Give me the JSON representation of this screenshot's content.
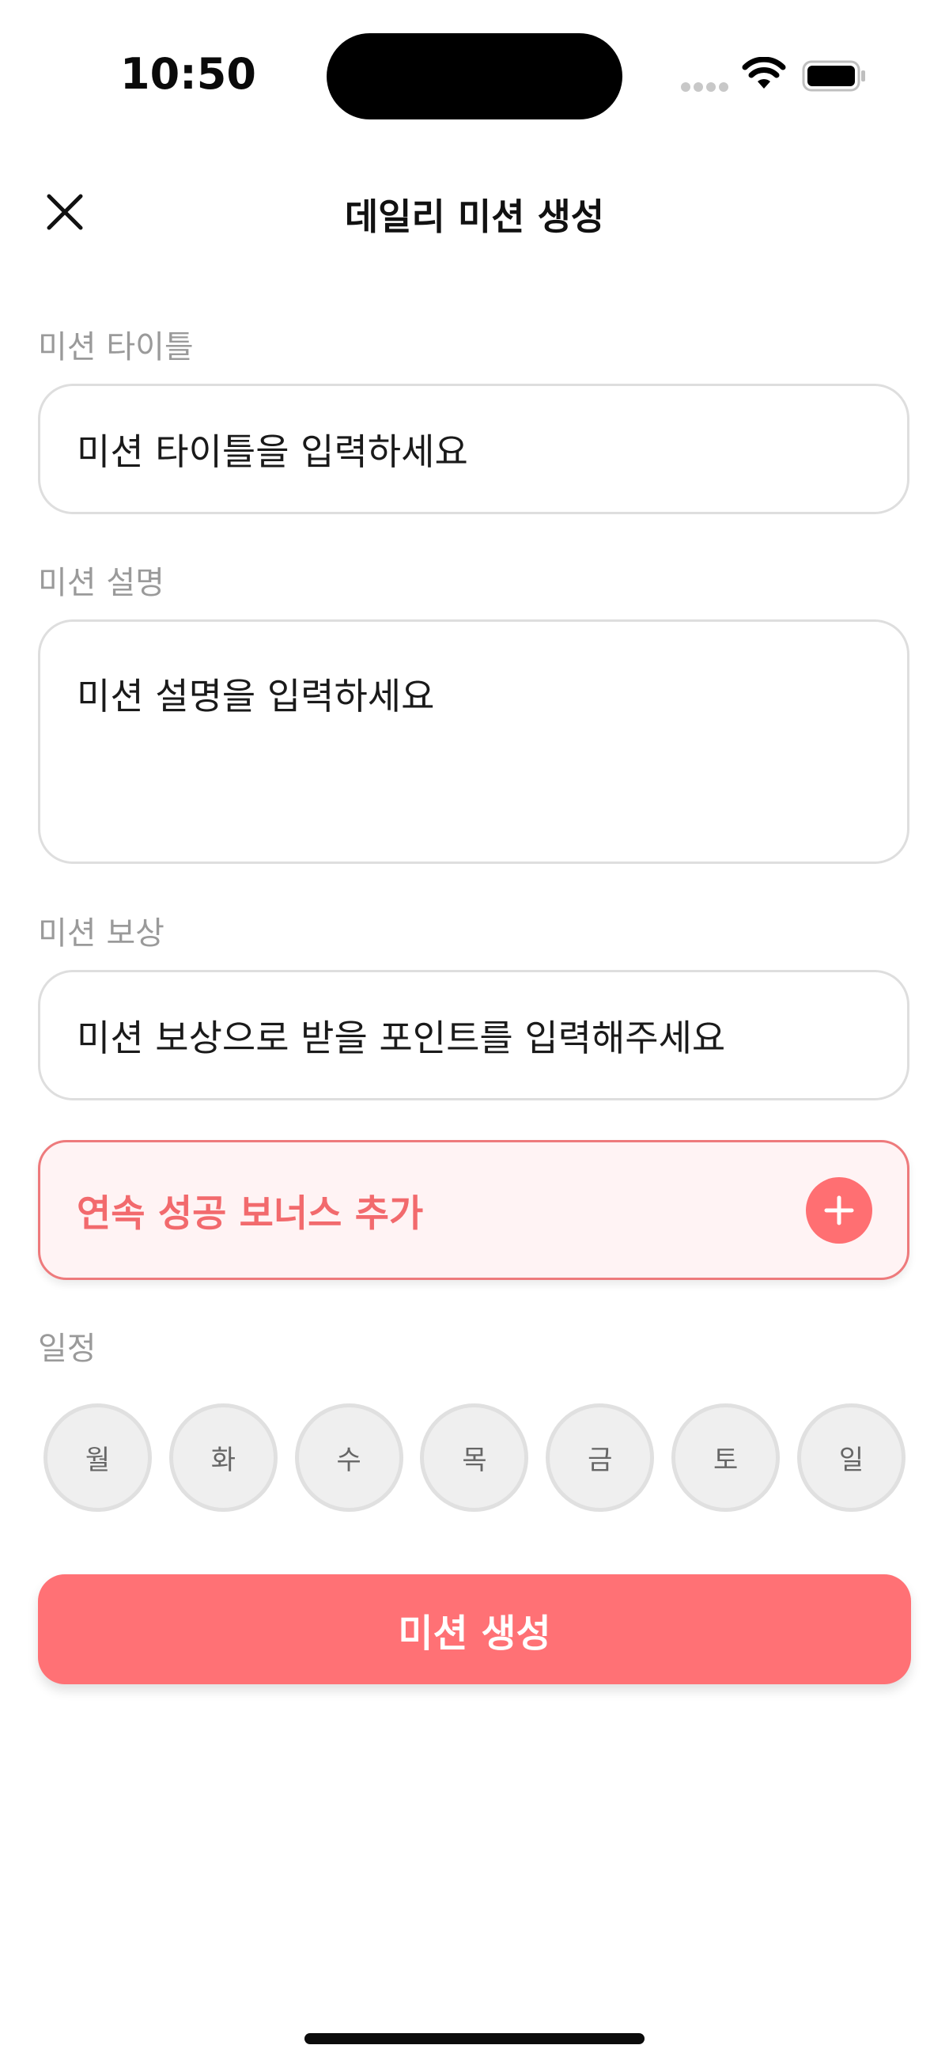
{
  "status_bar": {
    "time": "10:50"
  },
  "header": {
    "title": "데일리 미션 생성",
    "close_icon": "close-icon"
  },
  "form": {
    "title_label": "미션 타이틀",
    "title_placeholder": "미션 타이틀을 입력하세요",
    "description_label": "미션 설명",
    "description_placeholder": "미션 설명을 입력하세요",
    "reward_label": "미션 보상",
    "reward_placeholder": "미션 보상으로 받을 포인트를 입력해주세요",
    "bonus_label": "연속 성공 보너스 추가",
    "schedule_label": "일정",
    "days": [
      "월",
      "화",
      "수",
      "목",
      "금",
      "토",
      "일"
    ],
    "submit_label": "미션 생성"
  },
  "colors": {
    "accent": "#ff7175",
    "bonus_background": "#fff3f4",
    "label_gray": "#9a9a9a"
  }
}
